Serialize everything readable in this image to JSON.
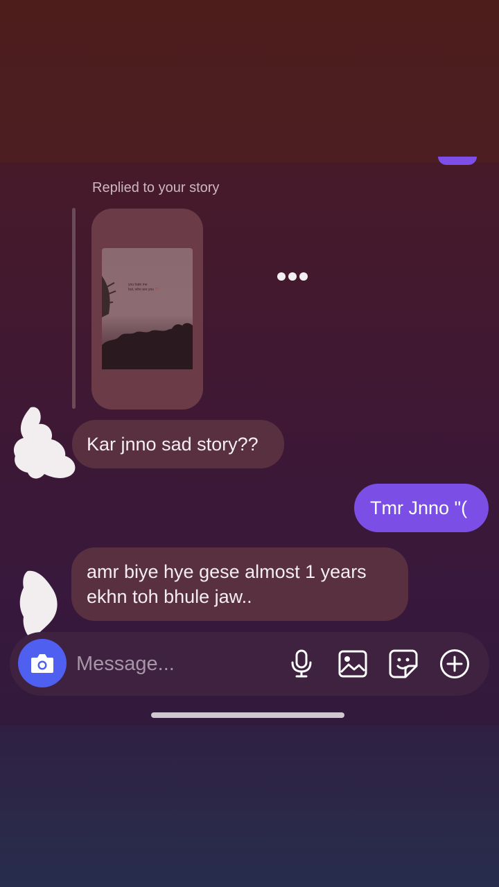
{
  "thread": {
    "reply_label": "Replied to your story",
    "story_preview": {
      "text_line1": "you hate me",
      "text_line2": "but, who are you",
      "text_mark": "??"
    },
    "messages": [
      {
        "side": "in",
        "lines": [
          "Kar jnno sad story??"
        ]
      },
      {
        "side": "out",
        "lines": [
          "Tmr Jnno \"("
        ]
      },
      {
        "side": "in",
        "lines": [
          "amr biye hye gese almost 1 years",
          "ekhn toh bhule jaw.."
        ]
      }
    ]
  },
  "composer": {
    "placeholder": "Message...",
    "icons": [
      "camera-icon",
      "microphone-icon",
      "gallery-icon",
      "sticker-icon",
      "add-icon"
    ]
  },
  "colors": {
    "outgoing_bubble": "#7b4fe6",
    "incoming_bubble": "#58303f",
    "camera_button": "#4f5ff0"
  }
}
